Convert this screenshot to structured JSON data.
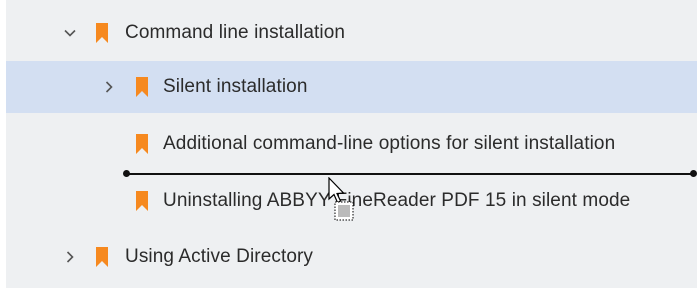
{
  "tree": {
    "items": [
      {
        "label": "Command line installation",
        "expanded": true
      },
      {
        "label": "Silent installation",
        "expanded": false,
        "selected": true
      },
      {
        "label": "Additional command-line options for silent installation"
      },
      {
        "label": "Uninstalling ABBYY FineReader PDF 15 in silent mode"
      },
      {
        "label": "Using Active Directory",
        "expanded": false
      }
    ]
  },
  "colors": {
    "bookmark": "#f6891f",
    "selection": "#d3dff2",
    "panel": "#eef0f2"
  },
  "icons": {
    "expand": "chevron-down-icon",
    "collapse": "chevron-right-icon",
    "bookmark": "bookmark-icon",
    "drag": "drag-move-cursor-icon"
  }
}
